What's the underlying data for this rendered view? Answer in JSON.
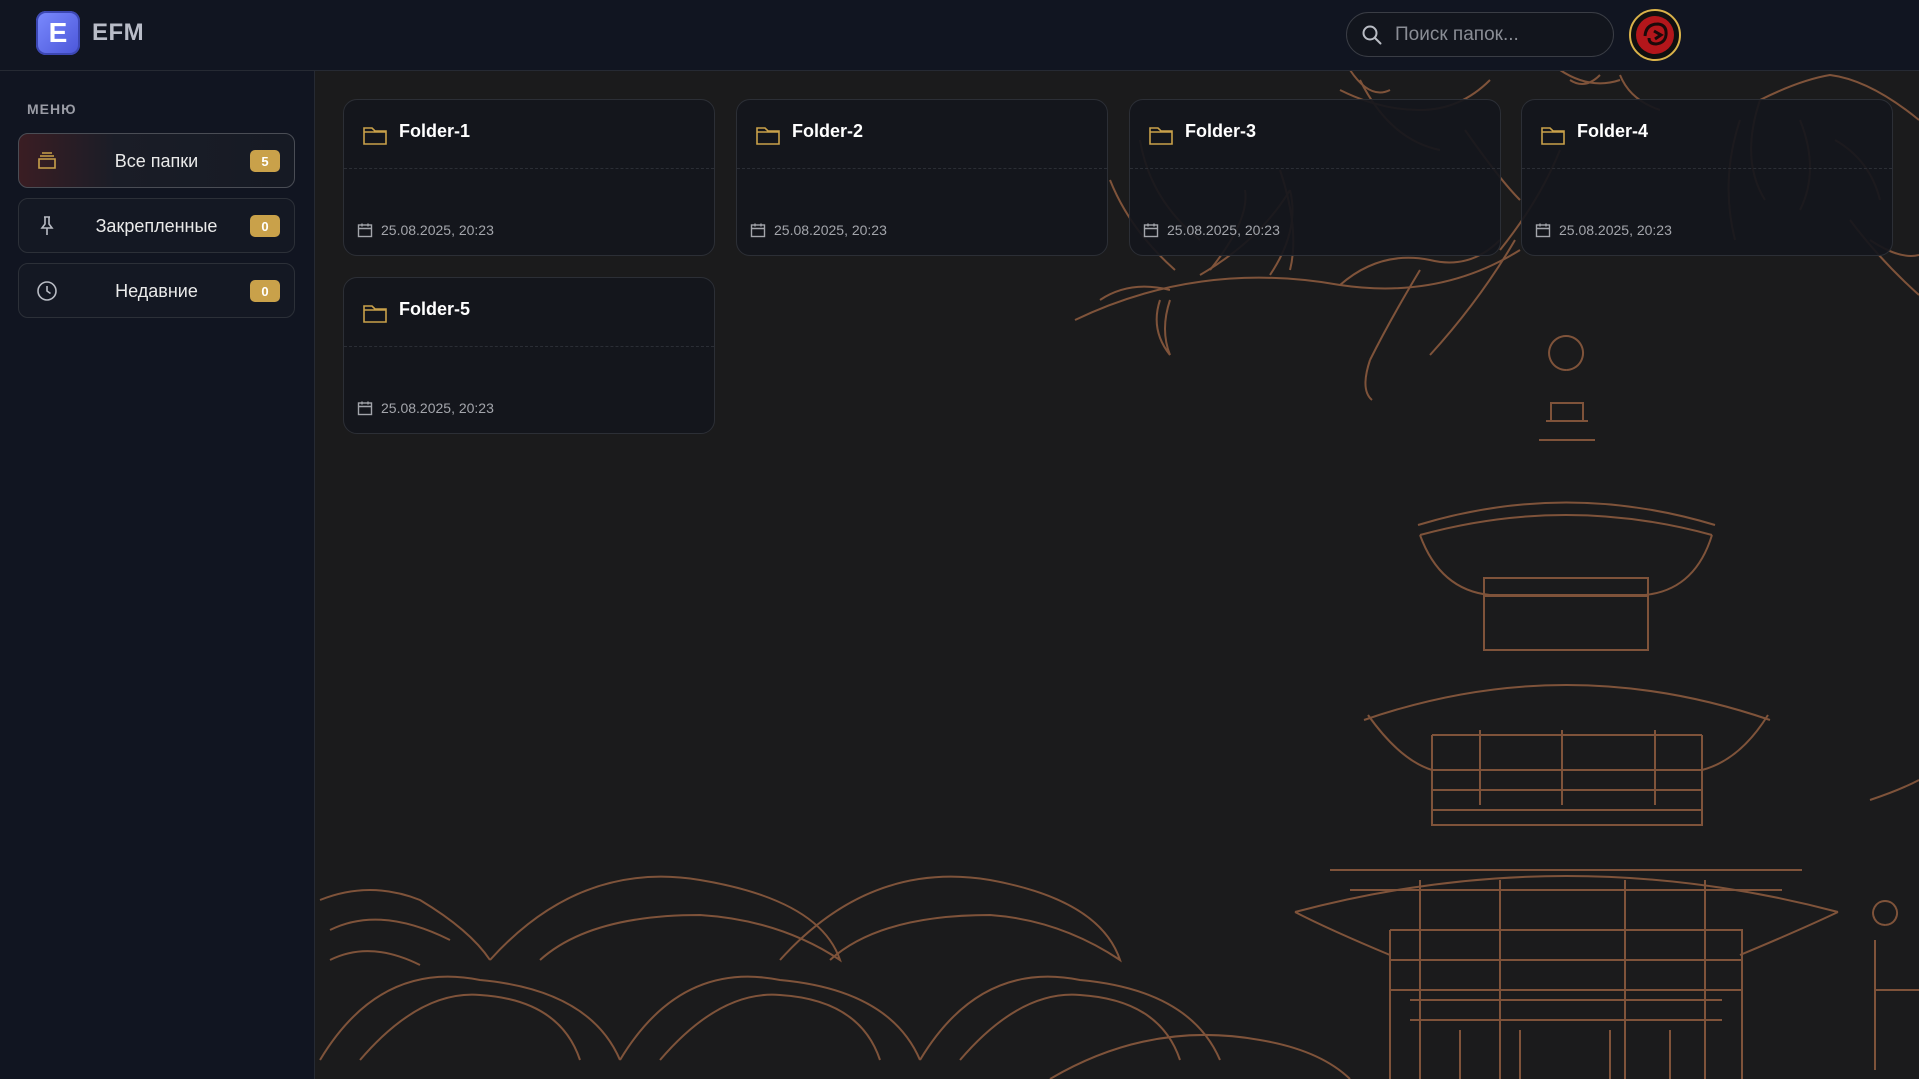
{
  "app": {
    "logo_letter": "E",
    "name": "EFM"
  },
  "search": {
    "placeholder": "Поиск папок..."
  },
  "sidebar": {
    "menu_title": "МЕНЮ",
    "items": [
      {
        "label": "Все папки",
        "count": "5",
        "icon": "stack-icon",
        "active": true
      },
      {
        "label": "Закрепленные",
        "count": "0",
        "icon": "pin-icon",
        "active": false
      },
      {
        "label": "Недавние",
        "count": "0",
        "icon": "clock-icon",
        "active": false
      }
    ]
  },
  "folders": [
    {
      "name": "Folder-1",
      "date": "25.08.2025, 20:23"
    },
    {
      "name": "Folder-2",
      "date": "25.08.2025, 20:23"
    },
    {
      "name": "Folder-3",
      "date": "25.08.2025, 20:23"
    },
    {
      "name": "Folder-4",
      "date": "25.08.2025, 20:23"
    },
    {
      "name": "Folder-5",
      "date": "25.08.2025, 20:23"
    }
  ],
  "colors": {
    "accent": "#c9a14a",
    "art": "#8a5a3e",
    "background": "#1b1b1c",
    "sidebar": "#111521"
  }
}
